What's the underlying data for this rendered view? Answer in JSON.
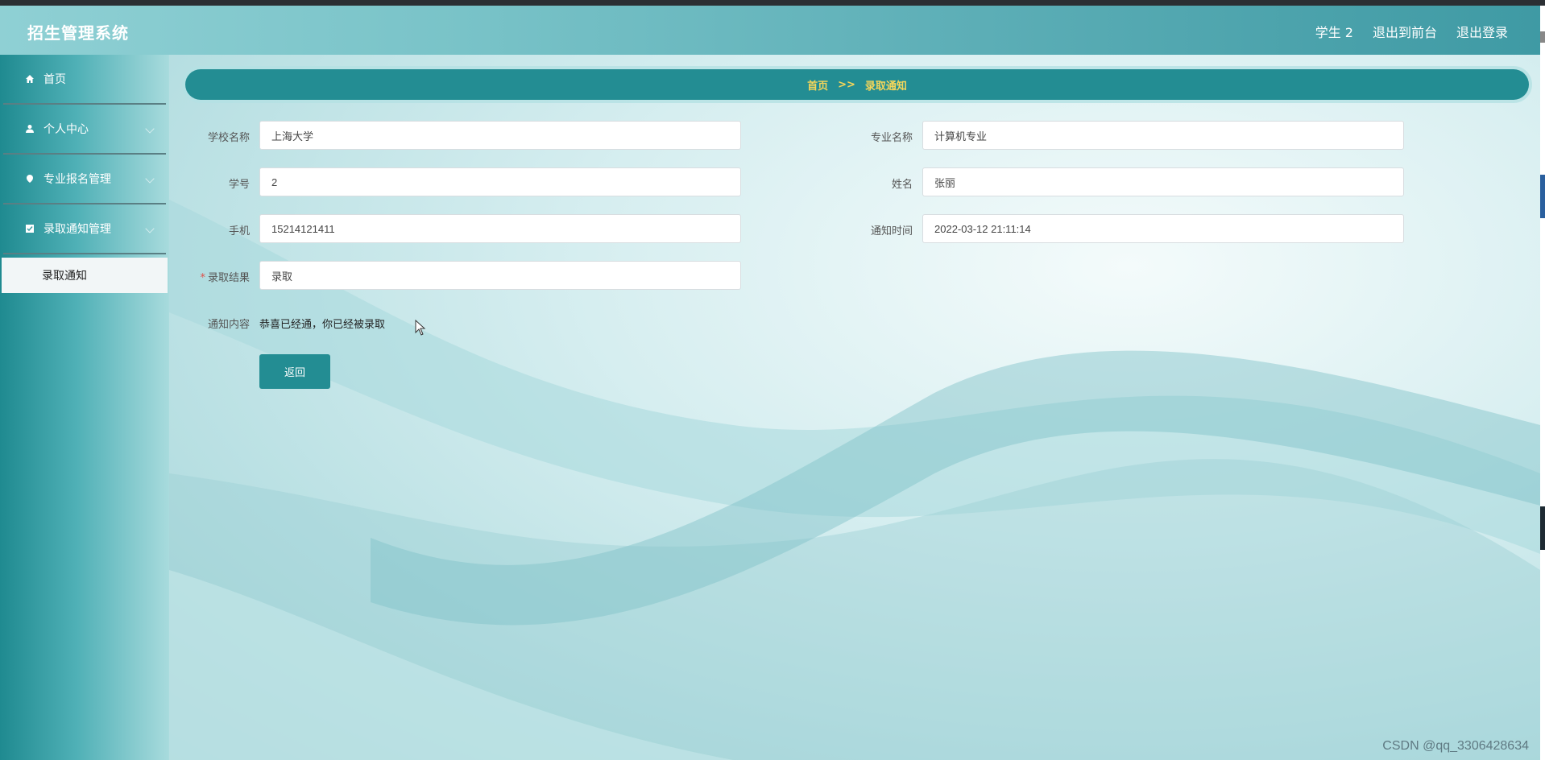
{
  "header": {
    "title": "招生管理系统",
    "links": [
      "学生 2",
      "退出到前台",
      "退出登录"
    ]
  },
  "sidebar": {
    "items": [
      {
        "label": "首页",
        "icon": "home-icon"
      },
      {
        "label": "个人中心",
        "icon": "user-icon"
      },
      {
        "label": "专业报名管理",
        "icon": "map-pin-icon"
      },
      {
        "label": "录取通知管理",
        "icon": "checkbox-icon"
      }
    ],
    "sub_item": "录取通知"
  },
  "breadcrumb": {
    "home": "首页",
    "separator": ">>",
    "current": "录取通知"
  },
  "form": {
    "school_name_label": "学校名称",
    "school_name_value": "上海大学",
    "major_label": "专业名称",
    "major_value": "计算机专业",
    "student_id_label": "学号",
    "student_id_value": "2",
    "name_label": "姓名",
    "name_value": "张丽",
    "phone_label": "手机",
    "phone_value": "15214121411",
    "notice_time_label": "通知时间",
    "notice_time_value": "2022-03-12 21:11:14",
    "result_required_mark": "*",
    "result_label": "录取结果",
    "result_value": "录取",
    "content_label": "通知内容",
    "content_value": "恭喜已经通，你已经被录取",
    "back_button": "返回"
  },
  "watermark": "CSDN @qq_3306428634",
  "colors": {
    "accent": "#238d93",
    "breadcrumb_text": "#f5d65a",
    "required": "#e0504a"
  }
}
